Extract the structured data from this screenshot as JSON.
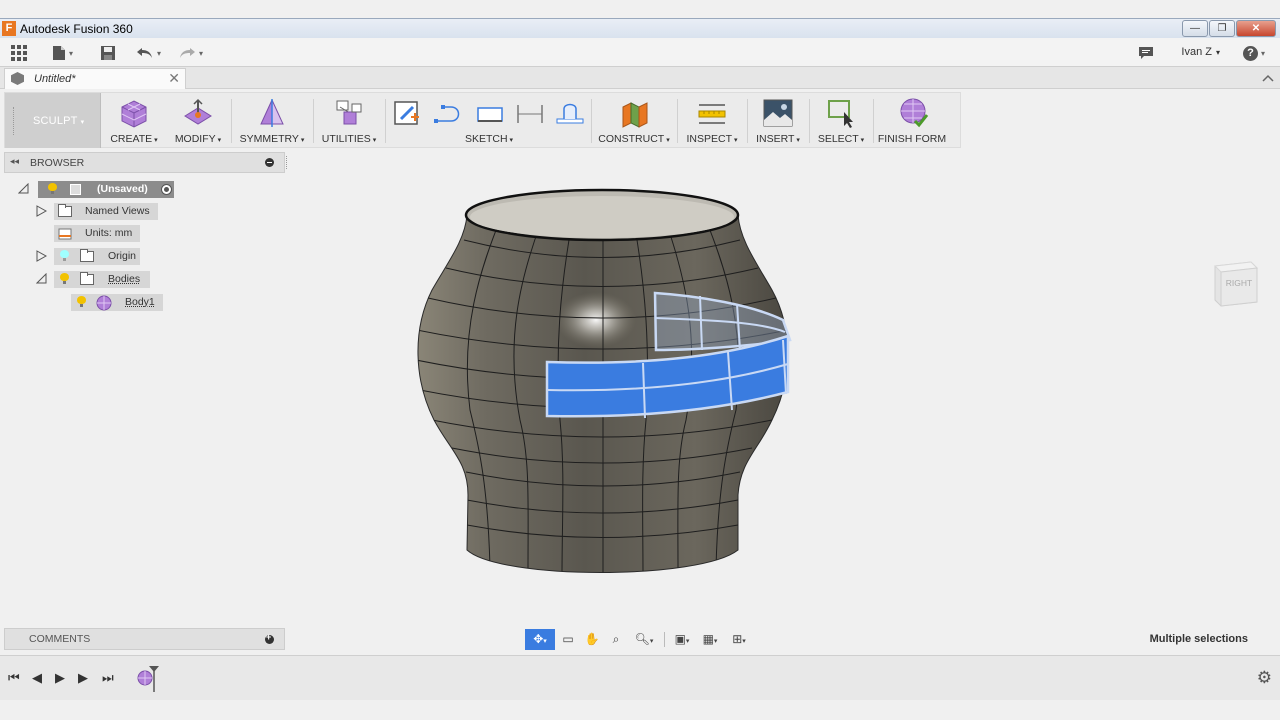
{
  "window": {
    "app_title": "Autodesk Fusion 360",
    "app_icon_letter": "F",
    "controls": [
      "—",
      "❐",
      "✕"
    ]
  },
  "quick_access": {
    "user_name": "Ivan Z",
    "help_label": "?"
  },
  "document_tab": {
    "title": "Untitled*",
    "close": "✕"
  },
  "ribbon": {
    "workspace": "SCULPT",
    "groups": {
      "create": "CREATE",
      "modify": "MODIFY",
      "symmetry": "SYMMETRY",
      "utilities": "UTILITIES",
      "sketch": "SKETCH",
      "construct": "CONSTRUCT",
      "inspect": "INSPECT",
      "insert": "INSERT",
      "select": "SELECT",
      "finish_form": "FINISH FORM"
    },
    "dropdown_glyph": "▾"
  },
  "browser": {
    "title": "BROWSER",
    "root": "(Unsaved)",
    "named_views": "Named Views",
    "units": "Units: mm",
    "origin": "Origin",
    "bodies": "Bodies",
    "body1": "Body1"
  },
  "viewcube": {
    "face": "RIGHT"
  },
  "comments": {
    "title": "COMMENTS"
  },
  "status": {
    "selection": "Multiple selections"
  },
  "colors": {
    "selection_blue": "#3a7ce0",
    "body_gray": "#6e6a60",
    "workspace_bg": "#cfcfcf"
  }
}
